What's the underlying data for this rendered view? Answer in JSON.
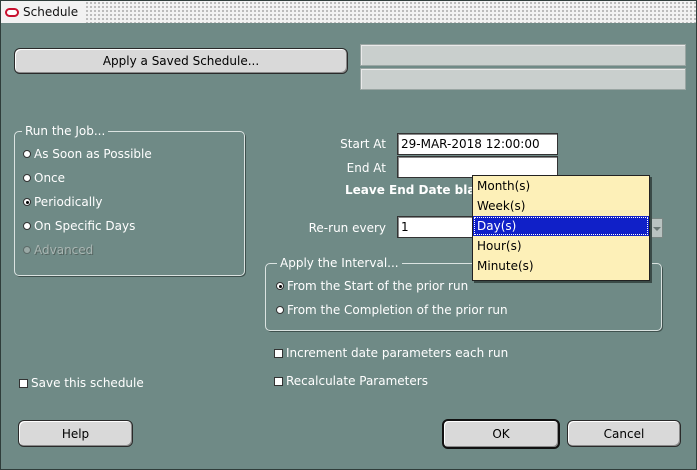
{
  "window": {
    "title": "Schedule"
  },
  "apply_saved_button": "Apply a Saved Schedule...",
  "run_job": {
    "legend": "Run the Job...",
    "options": [
      {
        "label": "As Soon as Possible",
        "selected": false,
        "enabled": true
      },
      {
        "label": "Once",
        "selected": false,
        "enabled": true
      },
      {
        "label": "Periodically",
        "selected": true,
        "enabled": true
      },
      {
        "label": "On Specific Days",
        "selected": false,
        "enabled": true
      },
      {
        "label": "Advanced",
        "selected": false,
        "enabled": false
      }
    ]
  },
  "start_at": {
    "label": "Start At",
    "value": "29-MAR-2018 12:00:00"
  },
  "end_at": {
    "label": "End At",
    "value": ""
  },
  "leave_end_note": "Leave End Date blar",
  "rerun": {
    "label": "Re-run every",
    "value": "1"
  },
  "interval_dropdown": {
    "options": [
      "Month(s)",
      "Week(s)",
      "Day(s)",
      "Hour(s)",
      "Minute(s)"
    ],
    "selected": "Day(s)"
  },
  "apply_interval": {
    "legend": "Apply the Interval...",
    "options": [
      {
        "label": "From the Start of the prior run",
        "selected": true
      },
      {
        "label": "From the Completion of the prior run",
        "selected": false
      }
    ]
  },
  "increment_checkbox": "Increment date parameters each run",
  "recalculate_checkbox": "Recalculate Parameters",
  "save_checkbox": "Save this schedule",
  "buttons": {
    "help": "Help",
    "ok": "OK",
    "cancel": "Cancel"
  },
  "colors": {
    "background": "#6f8a86",
    "dropdown_bg": "#fdf0b8",
    "selection": "#1020c8"
  }
}
